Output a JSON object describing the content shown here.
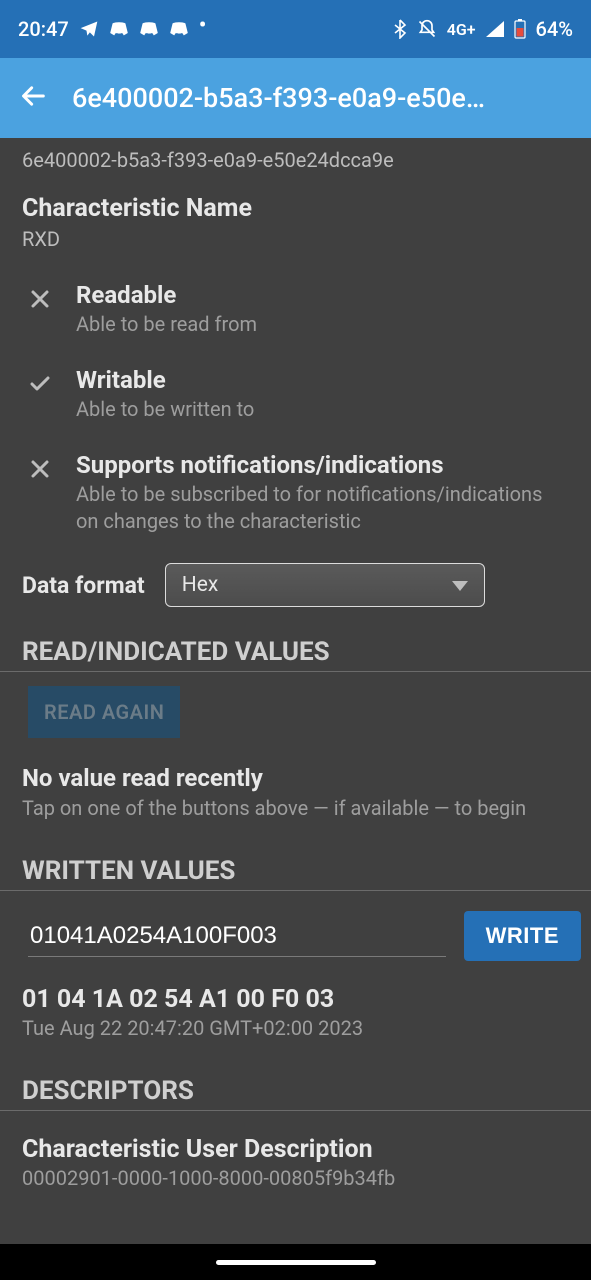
{
  "status": {
    "time": "20:47",
    "network": "4G+",
    "battery": "64%"
  },
  "header": {
    "title_truncated": "6e400002-b5a3-f393-e0a9-e50e…"
  },
  "uuid_full": "6e400002-b5a3-f393-e0a9-e50e24dcca9e",
  "characteristic": {
    "label": "Characteristic Name",
    "value": "RXD"
  },
  "capabilities": [
    {
      "ok": false,
      "title": "Readable",
      "desc": "Able to be read from"
    },
    {
      "ok": true,
      "title": "Writable",
      "desc": "Able to be written to"
    },
    {
      "ok": false,
      "title": "Supports notifications/indications",
      "desc": "Able to be subscribed to for notifications/indications on changes to the characteristic"
    }
  ],
  "data_format": {
    "label": "Data format",
    "selected": "Hex"
  },
  "sections": {
    "read_header": "READ/INDICATED VALUES",
    "read_again": "READ AGAIN",
    "no_value_title": "No value read recently",
    "no_value_desc": "Tap on one of the buttons above — if available — to begin",
    "written_header": "WRITTEN VALUES",
    "descriptors_header": "DESCRIPTORS"
  },
  "write": {
    "input_value": "01041A0254A100F003",
    "button": "WRITE",
    "last_written_hex": "01 04 1A 02 54 A1 00 F0 03",
    "last_written_time": "Tue Aug 22 20:47:20 GMT+02:00 2023"
  },
  "descriptor": {
    "title": "Characteristic User Description",
    "uuid": "00002901-0000-1000-8000-00805f9b34fb"
  }
}
